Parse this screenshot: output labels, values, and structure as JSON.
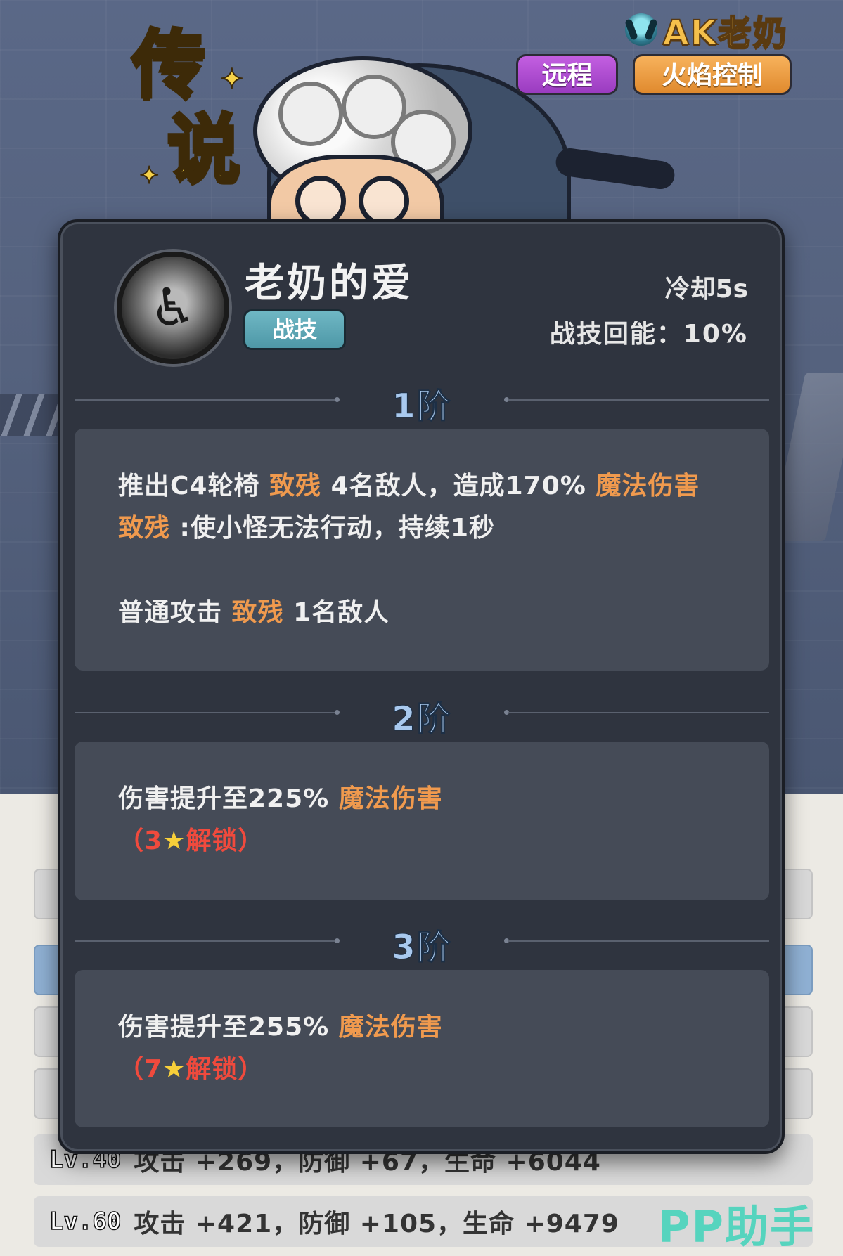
{
  "hero": {
    "name": "AK老奶",
    "class_icon": "class-emblem-icon",
    "rarity_chars": [
      "传",
      "说"
    ],
    "tags": [
      "远程",
      "火焰控制"
    ]
  },
  "skill": {
    "name": "老奶的爱",
    "type": "战技",
    "icon": "wheelchair-icon",
    "cooldown": "冷却5s",
    "energy_label": "战技回能：",
    "energy_value": "10%",
    "tiers": [
      {
        "label": "1阶",
        "lines": [
          [
            {
              "t": "推出C4轮椅 "
            },
            {
              "t": "致残",
              "c": "hl"
            },
            {
              "t": " 4名敌人，造成170% "
            },
            {
              "t": "魔法伤害",
              "c": "hl"
            }
          ],
          [
            {
              "t": "致残",
              "c": "hl"
            },
            {
              "t": " :使小怪无法行动，持续1秒"
            }
          ],
          [],
          [
            {
              "t": "普通攻击 "
            },
            {
              "t": "致残",
              "c": "hl"
            },
            {
              "t": " 1名敌人"
            }
          ]
        ]
      },
      {
        "label": "2阶",
        "lines": [
          [
            {
              "t": "伤害提升至225% "
            },
            {
              "t": "魔法伤害",
              "c": "hl"
            }
          ],
          [
            {
              "t": "（3",
              "c": "red"
            },
            {
              "t": "★",
              "c": "star"
            },
            {
              "t": "解锁）",
              "c": "red"
            }
          ]
        ]
      },
      {
        "label": "3阶",
        "lines": [
          [
            {
              "t": "伤害提升至255% "
            },
            {
              "t": "魔法伤害",
              "c": "hl"
            }
          ],
          [
            {
              "t": "（7",
              "c": "red"
            },
            {
              "t": "★",
              "c": "star"
            },
            {
              "t": "解锁）",
              "c": "red"
            }
          ]
        ]
      }
    ]
  },
  "levels": [
    {
      "lv": "Lv.40",
      "stats": "攻击 +269，防御 +67，生命 +6044"
    },
    {
      "lv": "Lv.60",
      "stats": "攻击 +421，防御 +105，生命 +9479"
    }
  ],
  "watermark": "PP助手",
  "colors": {
    "highlight": "#f09a4e",
    "locked": "#f04a3d",
    "tier_label": "#a9c9ee",
    "tag_ranged": "#b34fd6",
    "tag_fire": "#f0a04a",
    "skill_type": "#5fa8b6"
  }
}
